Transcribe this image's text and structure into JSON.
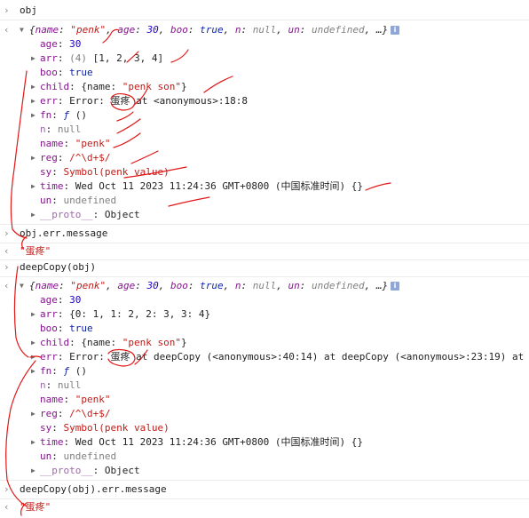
{
  "glyphs": {
    "chevron_in": "›",
    "chevron_out": "‹",
    "tri_down": "▼",
    "tri_right": "▶",
    "info": "i"
  },
  "block1": {
    "cmd": "obj",
    "summary": {
      "open": "{",
      "name_key": "name",
      "name_val": "\"penk\"",
      "age_key": "age",
      "age_val": "30",
      "boo_key": "boo",
      "boo_val": "true",
      "n_key": "n",
      "n_val": "null",
      "un_key": "un",
      "un_val": "undefined",
      "close": "…}"
    },
    "props": {
      "age_k": "age",
      "age_v": "30",
      "arr_k": "arr",
      "arr_len": "(4)",
      "arr_v": "[1, 2, 3, 4]",
      "boo_k": "boo",
      "boo_v": "true",
      "child_k": "child",
      "child_v_pre": "{name: ",
      "child_v_str": "\"penk son\"",
      "child_v_post": "}",
      "err_k": "err",
      "err_v_pre": "Error: ",
      "err_v_msg": "蛋疼",
      "err_v_post": " at <anonymous>:18:8",
      "fn_k": "fn",
      "fn_f": "ƒ",
      "fn_v": " ()",
      "n_k": "n",
      "n_v": "null",
      "name_k": "name",
      "name_v": "\"penk\"",
      "reg_k": "reg",
      "reg_v": "/^\\d+$/",
      "sy_k": "sy",
      "sy_v": "Symbol(penk value)",
      "time_k": "time",
      "time_v": "Wed Oct 11 2023 11:24:36 GMT+0800 (中国标准时间) {}",
      "un_k": "un",
      "un_v": "undefined",
      "proto_k": "__proto__",
      "proto_v": "Object"
    },
    "cmd2": "obj.err.message",
    "result2": "\"蛋疼\""
  },
  "block2": {
    "cmd": "deepCopy(obj)",
    "props": {
      "age_k": "age",
      "age_v": "30",
      "arr_k": "arr",
      "arr_v": "{0: 1, 1: 2, 2: 3, 3: 4}",
      "boo_k": "boo",
      "boo_v": "true",
      "child_k": "child",
      "child_v_pre": "{name: ",
      "child_v_str": "\"penk son\"",
      "child_v_post": "}",
      "err_k": "err",
      "err_v_pre": "Error: ",
      "err_v_msg": "蛋疼",
      "err_v_post": " at deepCopy (<anonymous>:40:14) at deepCopy (<anonymous>:23:19) at",
      "fn_k": "fn",
      "fn_f": "ƒ",
      "fn_v": " ()",
      "n_k": "n",
      "n_v": "null",
      "name_k": "name",
      "name_v": "\"penk\"",
      "reg_k": "reg",
      "reg_v": "/^\\d+$/",
      "sy_k": "sy",
      "sy_v": "Symbol(penk value)",
      "time_k": "time",
      "time_v": "Wed Oct 11 2023 11:24:36 GMT+0800 (中国标准时间) {}",
      "un_k": "un",
      "un_v": "undefined",
      "proto_k": "__proto__",
      "proto_v": "Object"
    },
    "cmd2": "deepCopy(obj).err.message",
    "result2": "\"蛋疼\""
  },
  "colors": {
    "annotation": "#e01818",
    "key": "#881391",
    "string": "#c41a16",
    "number": "#1c00cf"
  }
}
